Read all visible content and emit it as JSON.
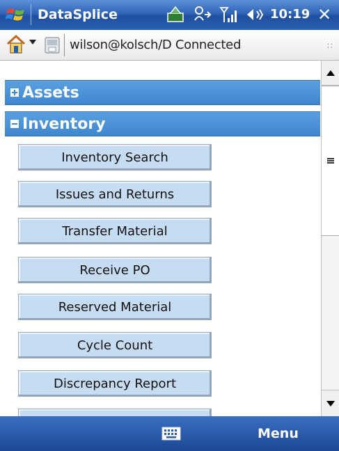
{
  "titlebar": {
    "app_title": "DataSplice",
    "clock": "10:19",
    "close_label": "✕"
  },
  "toolbar": {
    "connection_text": "wilson@kolsch/D Connected",
    "grip": "∷"
  },
  "sections": [
    {
      "label": "Assets",
      "expanded": false
    },
    {
      "label": "Inventory",
      "expanded": true
    }
  ],
  "inventory_buttons": [
    "Inventory Search",
    "Issues and Returns",
    "Transfer Material",
    "Receive PO",
    "Reserved Material",
    "Cycle Count",
    "Discrepancy Report"
  ],
  "softbar": {
    "right_label": "Menu"
  }
}
